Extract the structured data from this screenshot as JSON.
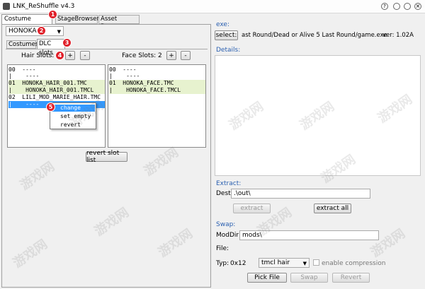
{
  "window": {
    "title": "LNK_ReShuffle v4.3"
  },
  "tabs": [
    "Costume Browser",
    "StageBrowser",
    "Asset Browser"
  ],
  "character_select": "HONOKA",
  "subtabs": [
    "Costumes",
    "DLC slots"
  ],
  "hair": {
    "label": "Hair Slots: 3",
    "add": "+",
    "remove": "-",
    "lines": [
      "00  ----",
      "|    ----",
      "01  HONOKA_HAIR_001.TMC",
      "|    HONOKA_HAIR_001.TMCL",
      "02  LILI_MOD_MARIE_HAIR.TMC",
      "|    ----"
    ]
  },
  "face": {
    "label": "Face Slots: 2",
    "add": "+",
    "remove": "-",
    "lines": [
      "00  ----",
      "|    ----",
      "01  HONOKA_FACE.TMC",
      "|    HONOKA_FACE.TMCL"
    ]
  },
  "context_menu": [
    "change",
    "set empty",
    "revert"
  ],
  "revert_slot_list": "revert slot list",
  "markers": [
    "1",
    "2",
    "3",
    "4",
    "5"
  ],
  "exe": {
    "group": "exe:",
    "select_button": "select:",
    "path": "ast Round/Dead or Alive 5 Last Round/game.exe",
    "version": "ver: 1.02A"
  },
  "details": {
    "group": "Details:"
  },
  "extract": {
    "group": "Extract:",
    "dest_label": "Dest:",
    "dest_value": ".\\out\\",
    "extract_button": "extract",
    "extract_all_button": "extract all"
  },
  "swap": {
    "group": "Swap:",
    "moddir_label": "ModDir:",
    "moddir_value": "mods\\",
    "file_label": "File:",
    "typ_label": "Typ:",
    "typ_value": "0x12",
    "type_select": "tmcl hair",
    "compression_label": "enable compression",
    "pick_file": "Pick File",
    "swap_button": "Swap",
    "revert_button": "Revert"
  },
  "watermark": [
    "游戏网",
    "游戏网",
    "游戏网",
    "游戏网",
    "游戏网",
    "游戏网",
    "游戏网",
    "游戏网",
    "游戏网",
    "游戏网",
    "游戏网",
    "游戏网"
  ]
}
